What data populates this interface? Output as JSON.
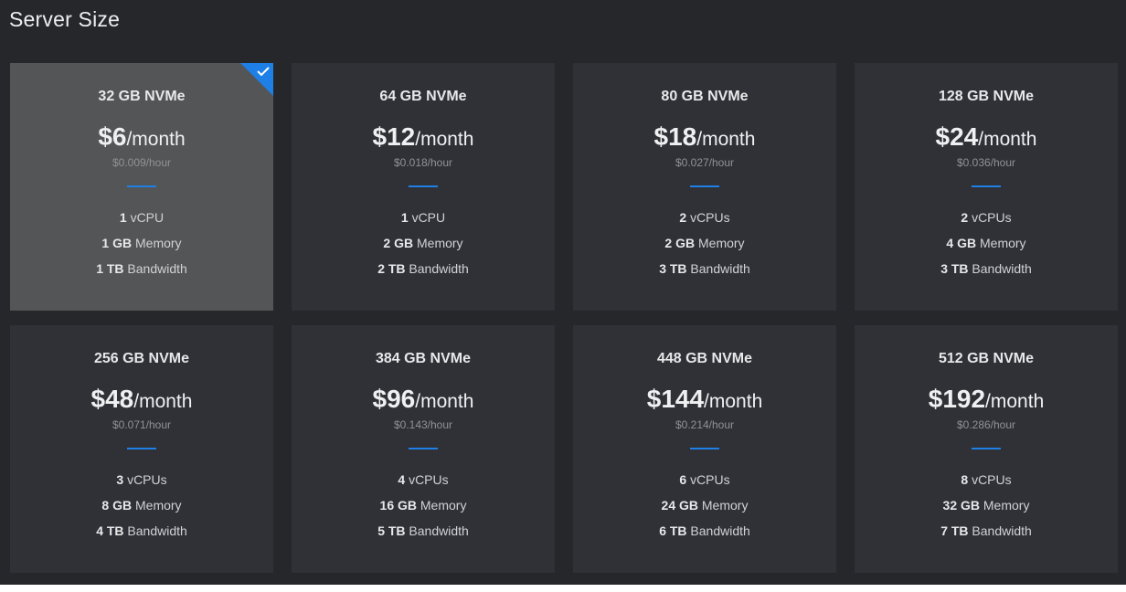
{
  "header": {
    "title": "Server Size"
  },
  "colors": {
    "accent": "#1e7fe6",
    "panel": "#25272b",
    "card": "#2f3136",
    "card_selected": "#545556"
  },
  "plans": [
    {
      "storage": "32 GB NVMe",
      "price": "$6",
      "per": "/month",
      "hourly": "$0.009/hour",
      "cpu_val": "1",
      "cpu_unit": "vCPU",
      "mem_val": "1 GB",
      "mem_unit": "Memory",
      "bw_val": "1 TB",
      "bw_unit": "Bandwidth",
      "selected": true
    },
    {
      "storage": "64 GB NVMe",
      "price": "$12",
      "per": "/month",
      "hourly": "$0.018/hour",
      "cpu_val": "1",
      "cpu_unit": "vCPU",
      "mem_val": "2 GB",
      "mem_unit": "Memory",
      "bw_val": "2 TB",
      "bw_unit": "Bandwidth",
      "selected": false
    },
    {
      "storage": "80 GB NVMe",
      "price": "$18",
      "per": "/month",
      "hourly": "$0.027/hour",
      "cpu_val": "2",
      "cpu_unit": "vCPUs",
      "mem_val": "2 GB",
      "mem_unit": "Memory",
      "bw_val": "3 TB",
      "bw_unit": "Bandwidth",
      "selected": false
    },
    {
      "storage": "128 GB NVMe",
      "price": "$24",
      "per": "/month",
      "hourly": "$0.036/hour",
      "cpu_val": "2",
      "cpu_unit": "vCPUs",
      "mem_val": "4 GB",
      "mem_unit": "Memory",
      "bw_val": "3 TB",
      "bw_unit": "Bandwidth",
      "selected": false
    },
    {
      "storage": "256 GB NVMe",
      "price": "$48",
      "per": "/month",
      "hourly": "$0.071/hour",
      "cpu_val": "3",
      "cpu_unit": "vCPUs",
      "mem_val": "8 GB",
      "mem_unit": "Memory",
      "bw_val": "4 TB",
      "bw_unit": "Bandwidth",
      "selected": false
    },
    {
      "storage": "384 GB NVMe",
      "price": "$96",
      "per": "/month",
      "hourly": "$0.143/hour",
      "cpu_val": "4",
      "cpu_unit": "vCPUs",
      "mem_val": "16 GB",
      "mem_unit": "Memory",
      "bw_val": "5 TB",
      "bw_unit": "Bandwidth",
      "selected": false
    },
    {
      "storage": "448 GB NVMe",
      "price": "$144",
      "per": "/month",
      "hourly": "$0.214/hour",
      "cpu_val": "6",
      "cpu_unit": "vCPUs",
      "mem_val": "24 GB",
      "mem_unit": "Memory",
      "bw_val": "6 TB",
      "bw_unit": "Bandwidth",
      "selected": false
    },
    {
      "storage": "512 GB NVMe",
      "price": "$192",
      "per": "/month",
      "hourly": "$0.286/hour",
      "cpu_val": "8",
      "cpu_unit": "vCPUs",
      "mem_val": "32 GB",
      "mem_unit": "Memory",
      "bw_val": "7 TB",
      "bw_unit": "Bandwidth",
      "selected": false
    }
  ]
}
